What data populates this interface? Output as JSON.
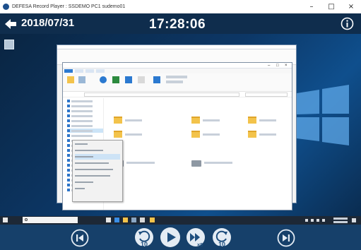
{
  "window": {
    "title": "DEFESA Record Player : SSDEMO PC1 sudemo01",
    "minimize": "–",
    "maximize": "□",
    "close": "×"
  },
  "header": {
    "date": "2018/07/31",
    "time": "17:28:06",
    "back_icon": "arrow-left-icon",
    "info_icon": "info-circle-icon"
  },
  "controls": {
    "skip_back_icon": "skip-previous-icon",
    "rewind_label": "10",
    "rewind_icon": "rewind-10-icon",
    "play_icon": "play-icon",
    "fast_forward_label": "×8",
    "fast_forward_icon": "fast-forward-icon",
    "forward_label": "10",
    "forward_icon": "forward-10-icon",
    "skip_next_icon": "skip-next-icon"
  },
  "colors": {
    "header_bg": "#0f2d4d",
    "control_bar_bg": "#16406a",
    "button_fill": "#e4ecf4",
    "button_icon": "#1e4e7e",
    "selection": "#cce4f7",
    "accent": "#2b79d0"
  }
}
